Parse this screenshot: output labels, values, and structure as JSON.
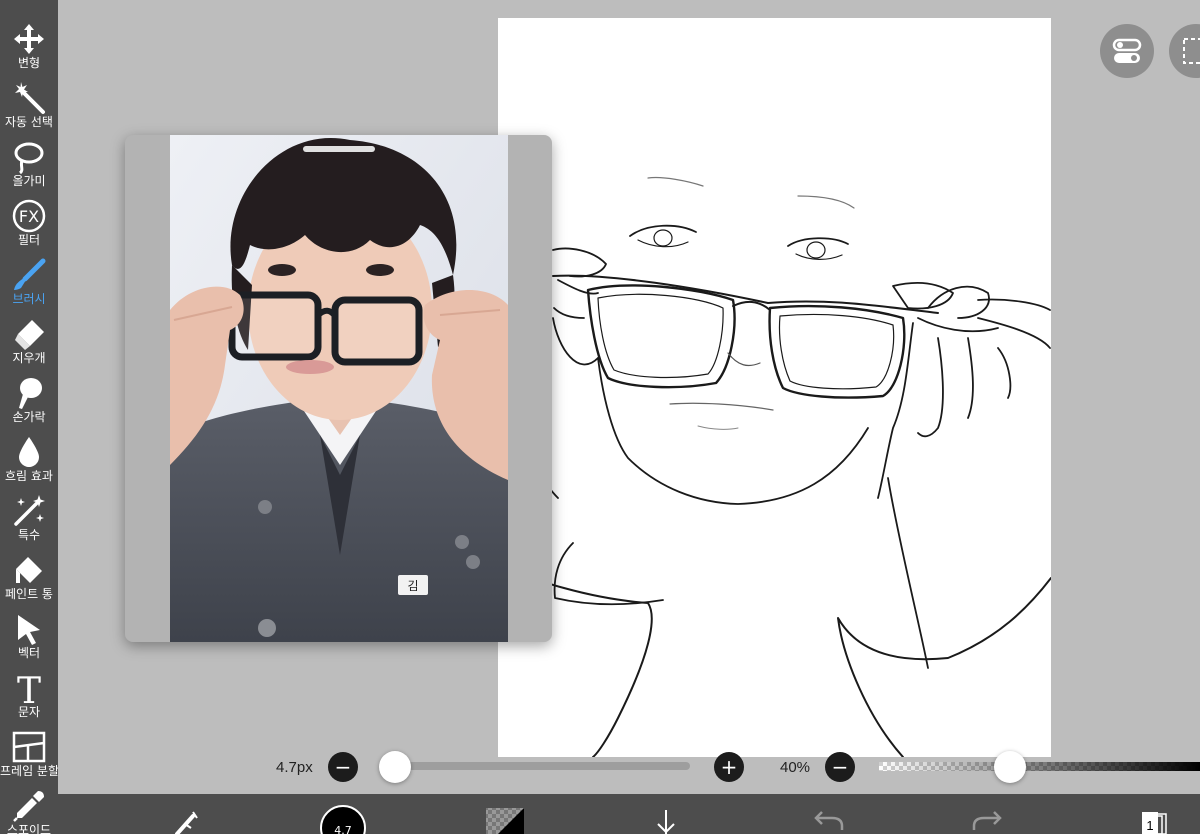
{
  "toolbar": {
    "tools": [
      {
        "label": "변형",
        "icon": "move-icon"
      },
      {
        "label": "자동 선택",
        "icon": "magic-wand-icon"
      },
      {
        "label": "올가미",
        "icon": "lasso-icon"
      },
      {
        "label": "필터",
        "icon": "fx-icon"
      },
      {
        "label": "브러시",
        "icon": "brush-icon",
        "active": true
      },
      {
        "label": "지우개",
        "icon": "eraser-icon"
      },
      {
        "label": "손가락",
        "icon": "finger-icon"
      },
      {
        "label": "흐림 효과",
        "icon": "blur-drop-icon"
      },
      {
        "label": "특수",
        "icon": "special-sparkle-icon"
      },
      {
        "label": "페인트 통",
        "icon": "paint-bucket-icon"
      },
      {
        "label": "벡터",
        "icon": "vector-arrow-icon"
      },
      {
        "label": "문자",
        "icon": "text-icon"
      },
      {
        "label": "프레임 분할",
        "icon": "frame-divider-icon"
      },
      {
        "label": "스포이드",
        "icon": "eyedropper-icon"
      }
    ],
    "fx_text": "FX",
    "text_glyph": "T",
    "active_color": "#4aa3f2"
  },
  "sliders": {
    "brush_size": "4.7px",
    "brush_size_value": 4.7,
    "opacity": "40%",
    "opacity_value": 0.4,
    "minus": "−",
    "plus": "+"
  },
  "reference": {
    "badge_text": "김"
  },
  "bottom_bar": {
    "brush_size_label": "4.7",
    "layer_count": "1"
  },
  "colors": {
    "toolbar_bg": "#4d4d4d",
    "workspace_bg": "#bdbdbd",
    "canvas_bg": "#ffffff",
    "accent": "#4aa3f2"
  }
}
